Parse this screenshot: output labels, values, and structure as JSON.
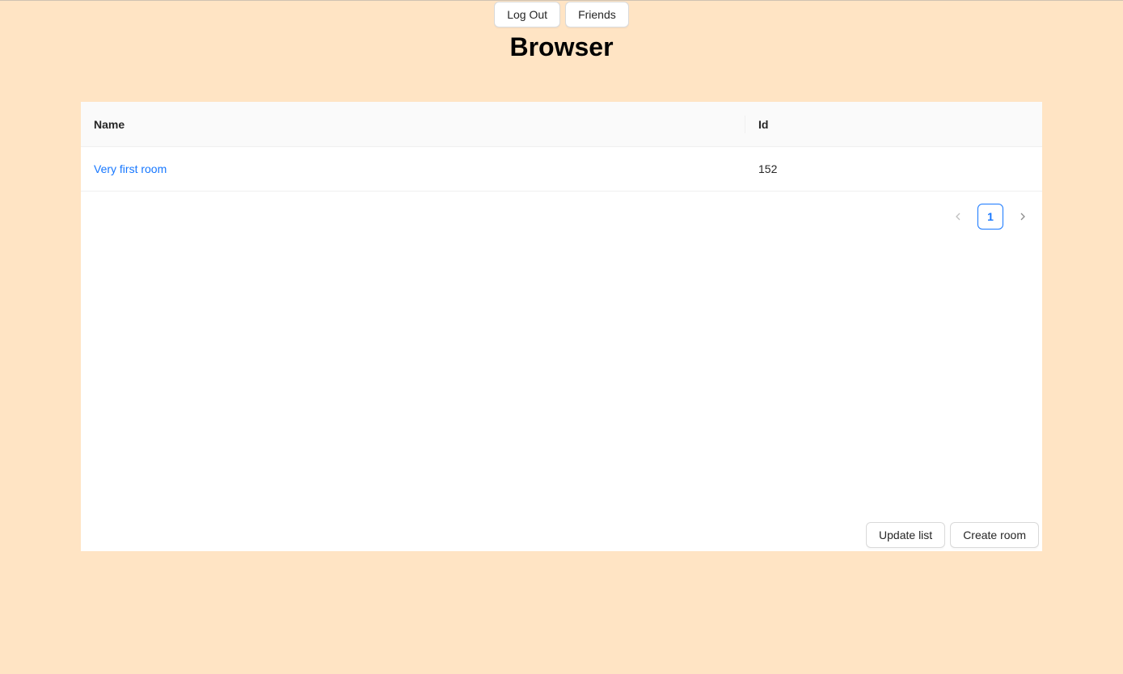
{
  "header": {
    "logout_label": "Log Out",
    "friends_label": "Friends",
    "title": "Browser"
  },
  "table": {
    "columns": {
      "name": "Name",
      "id": "Id"
    },
    "rows": [
      {
        "name": "Very first room",
        "id": "152"
      }
    ]
  },
  "pagination": {
    "current_page": "1",
    "prev_icon": "chevron-left-icon",
    "next_icon": "chevron-right-icon"
  },
  "actions": {
    "update_label": "Update list",
    "create_label": "Create room"
  },
  "colors": {
    "background": "#ffe4c4",
    "accent": "#1677ff"
  }
}
